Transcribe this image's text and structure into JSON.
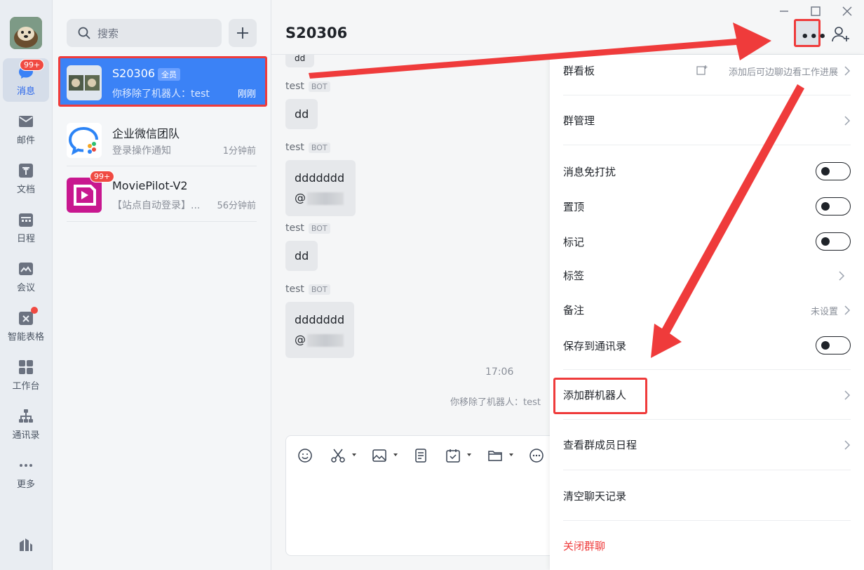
{
  "nav": {
    "badge_messages": "99+",
    "items": [
      {
        "label": "消息",
        "icon": "chat-bubble-icon"
      },
      {
        "label": "邮件",
        "icon": "mail-icon"
      },
      {
        "label": "文档",
        "icon": "document-icon"
      },
      {
        "label": "日程",
        "icon": "calendar-icon"
      },
      {
        "label": "会议",
        "icon": "meeting-icon"
      },
      {
        "label": "智能表格",
        "icon": "smart-table-icon"
      },
      {
        "label": "工作台",
        "icon": "workbench-icon"
      },
      {
        "label": "通讯录",
        "icon": "contacts-icon"
      },
      {
        "label": "更多",
        "icon": "more-dots-icon"
      }
    ]
  },
  "list": {
    "search_placeholder": "搜索",
    "conversations": [
      {
        "name": "S20306",
        "tag": "全员",
        "sub": "你移除了机器人：test",
        "time": "刚刚"
      },
      {
        "name": "企业微信团队",
        "sub": "登录操作通知",
        "time": "1分钟前"
      },
      {
        "name": "MoviePilot-V2",
        "sub": "【站点自动登录】...",
        "time": "56分钟前",
        "badge": "99+"
      }
    ]
  },
  "chat": {
    "title": "S20306",
    "messages": [
      {
        "sender": "test",
        "bot": "BOT",
        "text": "dd"
      },
      {
        "sender": "test",
        "bot": "BOT",
        "text": "ddddddd",
        "mention": "@"
      },
      {
        "sender": "test",
        "bot": "BOT",
        "text": "dd"
      },
      {
        "sender": "test",
        "bot": "BOT",
        "text": "ddddddd",
        "mention": "@"
      }
    ],
    "partial_top": "dd",
    "timestamp": "17:06",
    "system_message": "你移除了机器人：test"
  },
  "panel": {
    "board": {
      "label": "群看板",
      "hint": "添加后可边聊边看工作进展"
    },
    "manage": "群管理",
    "mute": "消息免打扰",
    "pin": "置顶",
    "mark": "标记",
    "labels": "标签",
    "remark": {
      "label": "备注",
      "value": "未设置"
    },
    "save_contacts": "保存到通讯录",
    "add_bot": "添加群机器人",
    "member_schedule": "查看群成员日程",
    "clear_history": "清空聊天记录",
    "close_group": "关闭群聊"
  },
  "colors": {
    "accent": "#3b82f6",
    "highlight": "#ef3b3b",
    "badge": "#f04a42"
  }
}
